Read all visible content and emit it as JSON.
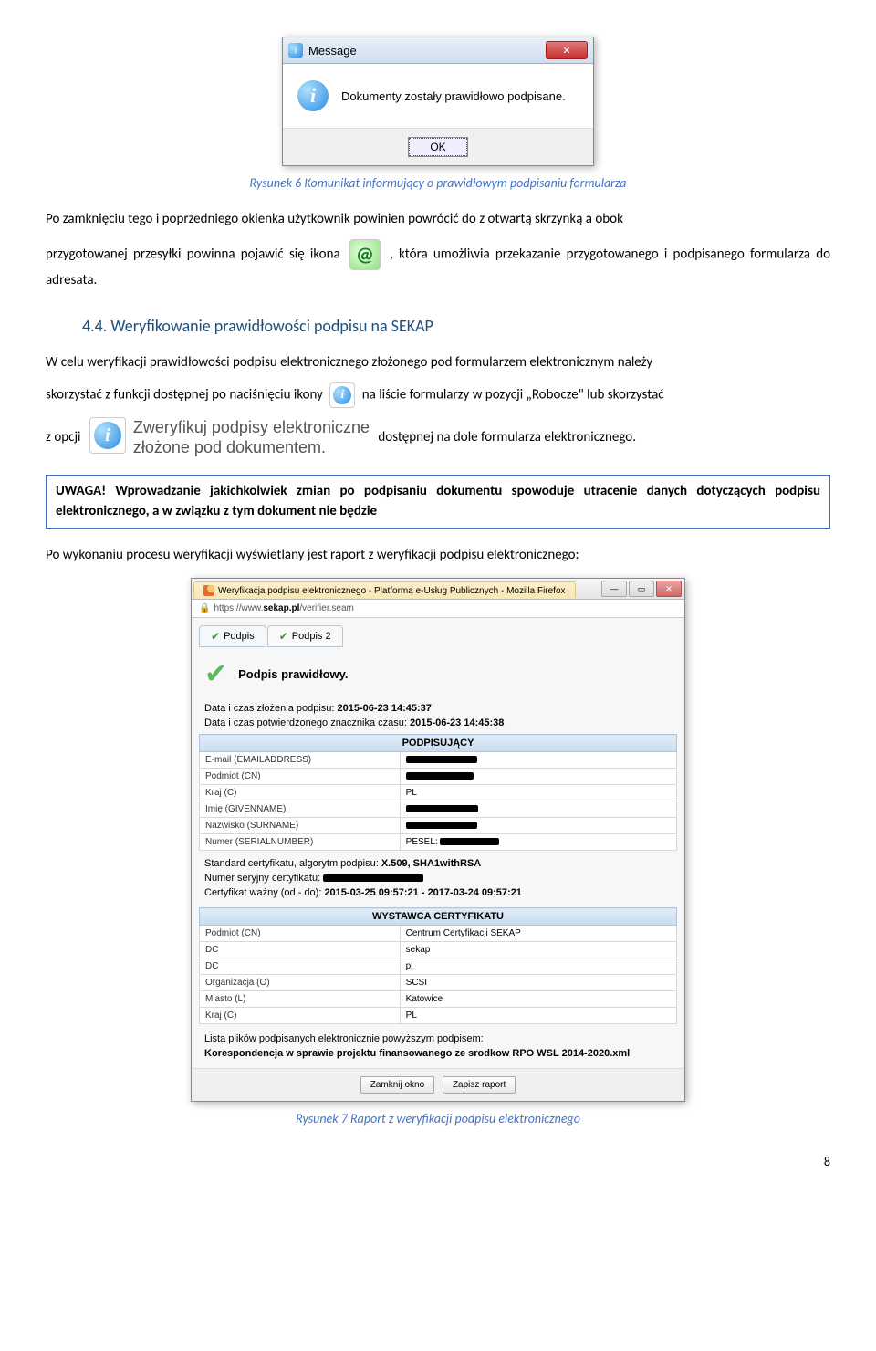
{
  "msgbox": {
    "title": "Message",
    "body": "Dokumenty zostały prawidłowo podpisane.",
    "ok": "OK"
  },
  "caption6": "Rysunek 6 Komunikat informujący o prawidłowym podpisaniu formularza",
  "p1a": "Po zamknięciu tego i poprzedniego okienka użytkownik powinien powrócić do z otwartą skrzynką a obok",
  "p1b": "przygotowanej przesyłki powinna pojawić się ikona",
  "p1c": ", która umożliwia przekazanie przygotowanego i podpisanego formularza do adresata.",
  "heading44": "4.4. Weryfikowanie prawidłowości podpisu na SEKAP",
  "p2": "W celu weryfikacji prawidłowości podpisu elektronicznego złożonego pod formularzem elektronicznym należy",
  "p3a": "skorzystać z funkcji dostępnej po naciśnięciu ikony",
  "p3b": "na liście formularzy w pozycji „Robocze\" lub skorzystać",
  "verify": {
    "l1": "Zweryfikuj podpisy elektroniczne",
    "l2": "złożone pod dokumentem."
  },
  "p4a": "z opcji",
  "p4b": "dostępnej na dole formularza elektronicznego.",
  "uwaga_label": "UWAGA!",
  "uwaga": " Wprowadzanie jakichkolwiek zmian po podpisaniu dokumentu spowoduje utracenie danych dotyczących podpisu elektronicznego, a w związku z tym dokument nie będzie",
  "p5": "Po wykonaniu procesu weryfikacji wyświetlany jest raport z weryfikacji podpisu elektronicznego:",
  "ff": {
    "win_title": "Weryfikacja podpisu elektronicznego - Platforma e-Usług Publicznych - Mozilla Firefox",
    "url_pre": "https://www.",
    "url_bold": "sekap.pl",
    "url_post": "/verifier.seam",
    "tab1": "Podpis",
    "tab2": "Podpis 2",
    "valid": "Podpis prawidłowy.",
    "d1": "Data i czas złożenia podpisu: ",
    "d1v": "2015-06-23 14:45:37",
    "d2": "Data i czas potwierdzonego znacznika czasu: ",
    "d2v": "2015-06-23 14:45:38",
    "hdr_signer": "PODPISUJĄCY",
    "rows_signer": [
      {
        "l": "E-mail (EMAILADDRESS)",
        "v": ""
      },
      {
        "l": "Podmiot (CN)",
        "v": ""
      },
      {
        "l": "Kraj (C)",
        "v": "PL"
      },
      {
        "l": "Imię (GIVENNAME)",
        "v": ""
      },
      {
        "l": "Nazwisko (SURNAME)",
        "v": ""
      },
      {
        "l": "Numer (SERIALNUMBER)",
        "v": "PESEL:"
      }
    ],
    "cert1": "Standard certyfikatu, algorytm podpisu: ",
    "cert1v": "X.509, SHA1withRSA",
    "cert2": "Numer seryjny certyfikatu: ",
    "cert3": "Certyfikat ważny (od - do): ",
    "cert3v": "2015-03-25 09:57:21 - 2017-03-24 09:57:21",
    "hdr_issuer": "WYSTAWCA CERTYFIKATU",
    "rows_issuer": [
      {
        "l": "Podmiot (CN)",
        "v": "Centrum Certyfikacji SEKAP"
      },
      {
        "l": "DC",
        "v": "sekap"
      },
      {
        "l": "DC",
        "v": "pl"
      },
      {
        "l": "Organizacja (O)",
        "v": "SCSI"
      },
      {
        "l": "Miasto (L)",
        "v": "Katowice"
      },
      {
        "l": "Kraj (C)",
        "v": "PL"
      }
    ],
    "list_lbl": "Lista plików podpisanych elektronicznie powyższym podpisem:",
    "list_file": "Korespondencja w sprawie projektu finansowanego ze srodkow RPO WSL 2014-2020.xml",
    "btn_close": "Zamknij okno",
    "btn_save": "Zapisz raport"
  },
  "caption7": "Rysunek 7 Raport z weryfikacji podpisu elektronicznego",
  "pagenum": "8"
}
